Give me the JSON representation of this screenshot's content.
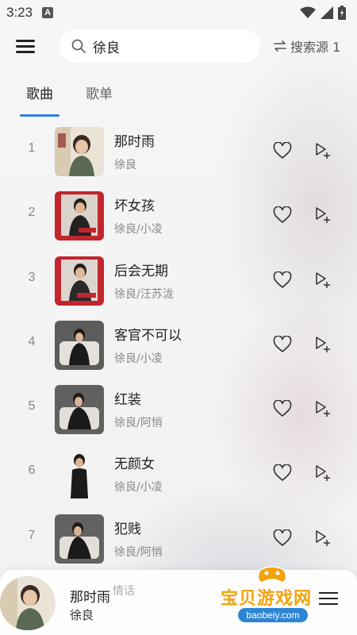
{
  "status_bar": {
    "time": "3:23",
    "notif_glyph": "A"
  },
  "header": {
    "search_value": "徐良",
    "source_label": "搜索源 1"
  },
  "tabs": [
    {
      "label": "歌曲"
    },
    {
      "label": "歌单"
    }
  ],
  "songs": [
    {
      "num": "1",
      "title": "那时雨",
      "artist": "徐良"
    },
    {
      "num": "2",
      "title": "坏女孩",
      "artist": "徐良/小凌"
    },
    {
      "num": "3",
      "title": "后会无期",
      "artist": "徐良/汪苏泷"
    },
    {
      "num": "4",
      "title": "客官不可以",
      "artist": "徐良/小凌"
    },
    {
      "num": "5",
      "title": "红装",
      "artist": "徐良/阿悄"
    },
    {
      "num": "6",
      "title": "无颜女",
      "artist": "徐良/小凌"
    },
    {
      "num": "7",
      "title": "犯贱",
      "artist": "徐良/阿悄"
    }
  ],
  "player": {
    "title": "那时雨",
    "artist": "徐良",
    "lyric_fragment": "情话"
  },
  "watermark": {
    "text": "宝贝游戏网",
    "url": "baobeiy.com"
  },
  "colors": {
    "accent": "#2f7ee6",
    "cover_red": "#c2262c",
    "watermark_orange": "#f2a20f"
  },
  "icons": {
    "menu": "menu-icon",
    "search": "search-icon",
    "swap": "swap-icon",
    "heart": "heart-icon",
    "add_to_queue": "add-to-queue-icon",
    "playlist": "playlist-icon"
  }
}
